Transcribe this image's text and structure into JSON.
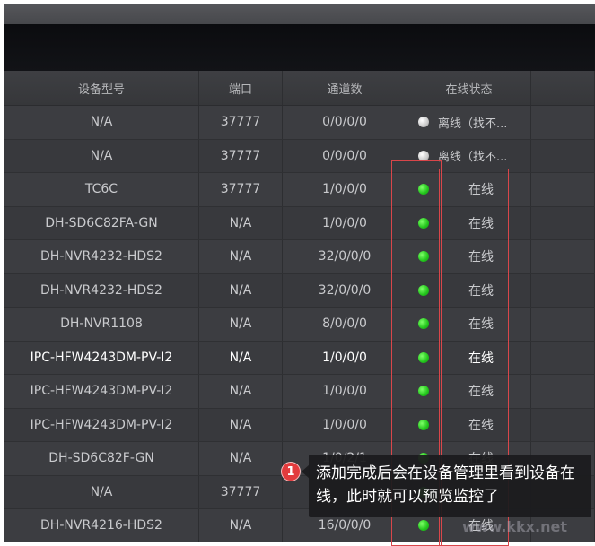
{
  "table": {
    "columns": [
      "设备型号",
      "端口",
      "通道数",
      "在线状态",
      ""
    ],
    "rows": [
      {
        "model": "N/A",
        "port": "37777",
        "channels": "0/0/0/0",
        "status": "离线（找不...",
        "state": "offline",
        "bright": false
      },
      {
        "model": "N/A",
        "port": "37777",
        "channels": "0/0/0/0",
        "status": "离线（找不...",
        "state": "offline",
        "bright": false
      },
      {
        "model": "TC6C",
        "port": "37777",
        "channels": "1/0/0/0",
        "status": "在线",
        "state": "online",
        "bright": false
      },
      {
        "model": "DH-SD6C82FA-GN",
        "port": "N/A",
        "channels": "1/0/0/0",
        "status": "在线",
        "state": "online",
        "bright": false
      },
      {
        "model": "DH-NVR4232-HDS2",
        "port": "N/A",
        "channels": "32/0/0/0",
        "status": "在线",
        "state": "online",
        "bright": false
      },
      {
        "model": "DH-NVR4232-HDS2",
        "port": "N/A",
        "channels": "32/0/0/0",
        "status": "在线",
        "state": "online",
        "bright": false
      },
      {
        "model": "DH-NVR1108",
        "port": "N/A",
        "channels": "8/0/0/0",
        "status": "在线",
        "state": "online",
        "bright": false
      },
      {
        "model": "IPC-HFW4243DM-PV-I2",
        "port": "N/A",
        "channels": "1/0/0/0",
        "status": "在线",
        "state": "online",
        "bright": true
      },
      {
        "model": "IPC-HFW4243DM-PV-I2",
        "port": "N/A",
        "channels": "1/0/0/0",
        "status": "在线",
        "state": "online",
        "bright": false
      },
      {
        "model": "IPC-HFW4243DM-PV-I2",
        "port": "N/A",
        "channels": "1/0/0/0",
        "status": "在线",
        "state": "online",
        "bright": false
      },
      {
        "model": "DH-SD6C82F-GN",
        "port": "N/A",
        "channels": "1/0/2/1",
        "status": "在线",
        "state": "online",
        "bright": false
      },
      {
        "model": "N/A",
        "port": "37777",
        "channels": "",
        "status": "",
        "state": "online",
        "bright": false
      },
      {
        "model": "DH-NVR4216-HDS2",
        "port": "N/A",
        "channels": "16/0/0/0",
        "status": "在线",
        "state": "online",
        "bright": false
      }
    ]
  },
  "callout": {
    "badge": "1",
    "text": "添加完成后会在设备管理里看到设备在线，此时就可以预览监控了"
  },
  "watermark": "www.kkx.net",
  "colors": {
    "online": "#2fd12a",
    "offline": "#c8c8c8",
    "highlight": "#d9464a"
  }
}
